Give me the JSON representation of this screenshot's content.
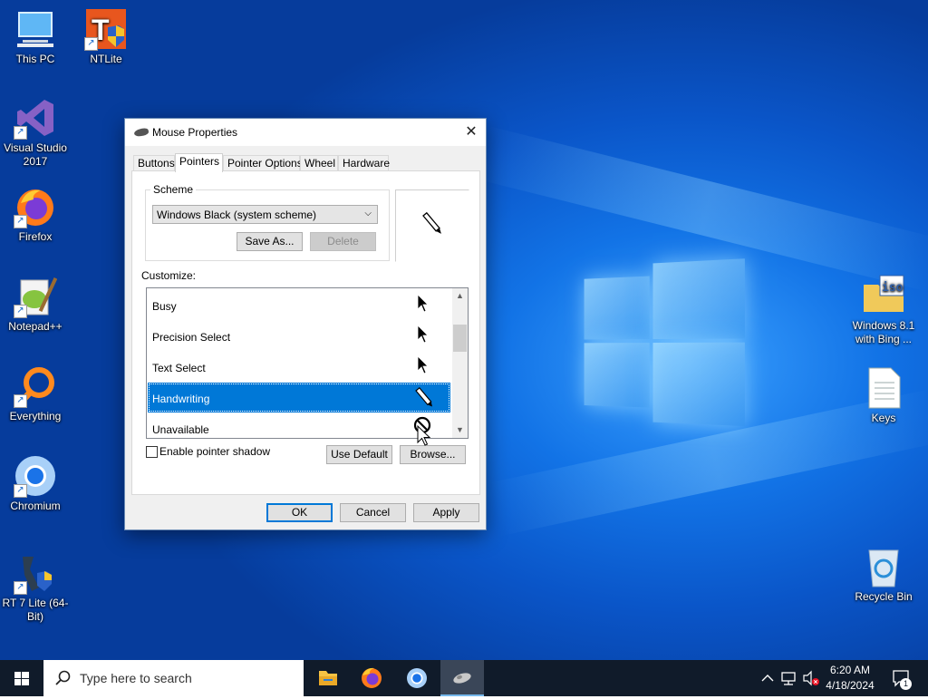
{
  "desktop": {
    "icons_left": [
      {
        "label": "This PC"
      },
      {
        "label": "NTLite"
      },
      {
        "label": "Visual Studio 2017"
      },
      {
        "label": "Firefox"
      },
      {
        "label": "Notepad++"
      },
      {
        "label": "Everything"
      },
      {
        "label": "Chromium"
      },
      {
        "label": "RT 7 Lite (64-Bit)"
      }
    ],
    "icons_right": [
      {
        "label": "Windows 8.1 with Bing ..."
      },
      {
        "label": "Keys"
      },
      {
        "label": "Recycle Bin"
      }
    ]
  },
  "dialog": {
    "title": "Mouse Properties",
    "close_glyph": "✕",
    "tabs": [
      "Buttons",
      "Pointers",
      "Pointer Options",
      "Wheel",
      "Hardware"
    ],
    "active_tab": "Pointers",
    "scheme": {
      "legend": "Scheme",
      "selected": "Windows Black (system scheme)",
      "save_as_label": "Save As...",
      "delete_label": "Delete"
    },
    "customize_label": "Customize:",
    "pointer_list": [
      {
        "name": "Busy",
        "icon": "arrow-cursor-icon"
      },
      {
        "name": "Precision Select",
        "icon": "arrow-cursor-icon"
      },
      {
        "name": "Text Select",
        "icon": "arrow-cursor-icon"
      },
      {
        "name": "Handwriting",
        "icon": "pen-cursor-icon",
        "selected": true
      },
      {
        "name": "Unavailable",
        "icon": "unavailable-cursor-icon"
      }
    ],
    "enable_shadow_label": "Enable pointer shadow",
    "enable_shadow_checked": false,
    "use_default_label": "Use Default",
    "browse_label": "Browse...",
    "ok_label": "OK",
    "cancel_label": "Cancel",
    "apply_label": "Apply"
  },
  "taskbar": {
    "search_placeholder": "Type here to search",
    "apps": [
      "file-explorer-icon",
      "firefox-icon",
      "chromium-icon",
      "mouse-properties-icon"
    ],
    "clock_time": "6:20 AM",
    "clock_date": "4/18/2024",
    "notification_count": "1"
  },
  "colors": {
    "accent": "#0078d7",
    "taskbar": "#101b2a",
    "wallpaper": "#0a55c8"
  }
}
